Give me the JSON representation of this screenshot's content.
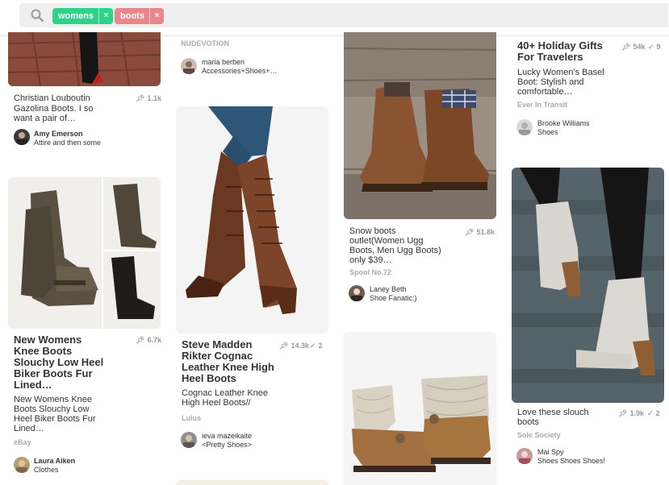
{
  "search": {
    "filters": [
      {
        "label": "womens",
        "color": "#2ed38a"
      },
      {
        "label": "boots",
        "color": "#e8878b"
      }
    ],
    "remove_glyph": "×"
  },
  "pins": {
    "louboutin": {
      "title": "Christian Louboutin Gazolina Boots. I so want a pair of…",
      "title_lines": [
        "Christian Louboutin",
        "Gazolina Boots. I so",
        "want a pair of…"
      ],
      "repins": "1.1k",
      "user": "Amy Emerson",
      "board": "Attire and then some"
    },
    "slouchy": {
      "title_lines": [
        "New Womens",
        "Knee Boots",
        "Slouchy Low Heel",
        "Biker Boots Fur",
        "Lined…"
      ],
      "repins": "6.7k",
      "desc_lines": [
        "New Womens Knee",
        "Boots Slouchy Low",
        "Heel Biker Boots Fur",
        "Lined…"
      ],
      "source": "eBay",
      "user": "Laura Aiken",
      "board": "Clothes"
    },
    "nudevotion": {
      "source": "NUDEVOTION",
      "user": "maria berberi",
      "board": "Accessories+Shoes+…"
    },
    "steve_madden": {
      "title_lines": [
        "Steve Madden",
        "Rikter Cognac",
        "Leather Knee High",
        "Heel Boots"
      ],
      "repins": "14.3k",
      "likes": "2",
      "desc_lines": [
        "Cognac Leather Knee",
        "High Heel Boots//"
      ],
      "source": "Lulus",
      "user": "ieva mazeikaite",
      "board": "<Pretty Shoes>"
    },
    "snow_boots": {
      "desc_lines": [
        "Snow boots",
        "outlet(Women Ugg",
        "Boots, Men Ugg Boots)",
        "only $39…"
      ],
      "repins": "51.8k",
      "source": "Spool No.72",
      "user": "Laney Beth",
      "board": "Shoe Fanatic:)"
    },
    "holiday": {
      "title_lines": [
        "40+ Holiday Gifts",
        "For Travelers"
      ],
      "repins": "54k",
      "likes": "9",
      "desc_lines": [
        "Lucky Women's Basel",
        "Boot: Stylish and",
        "comfortable…"
      ],
      "source": "Ever In Transit",
      "user": "Brooke Williams",
      "board": "Shoes"
    },
    "slouch": {
      "desc_lines": [
        "Love these slouch",
        "boots"
      ],
      "repins": "1.9k",
      "likes": "2",
      "source": "Sole Society",
      "user": "Mai Spy",
      "board": "Shoes Shoes Shoes!"
    }
  },
  "icons": {
    "search": "search-icon",
    "pin": "pin-icon",
    "check": "check-icon",
    "remove": "close-icon"
  },
  "colors": {
    "chip_green": "#2ed38a",
    "chip_pink": "#e8878b",
    "searchbar_bg": "#efefef",
    "meta_gray": "#999999"
  }
}
